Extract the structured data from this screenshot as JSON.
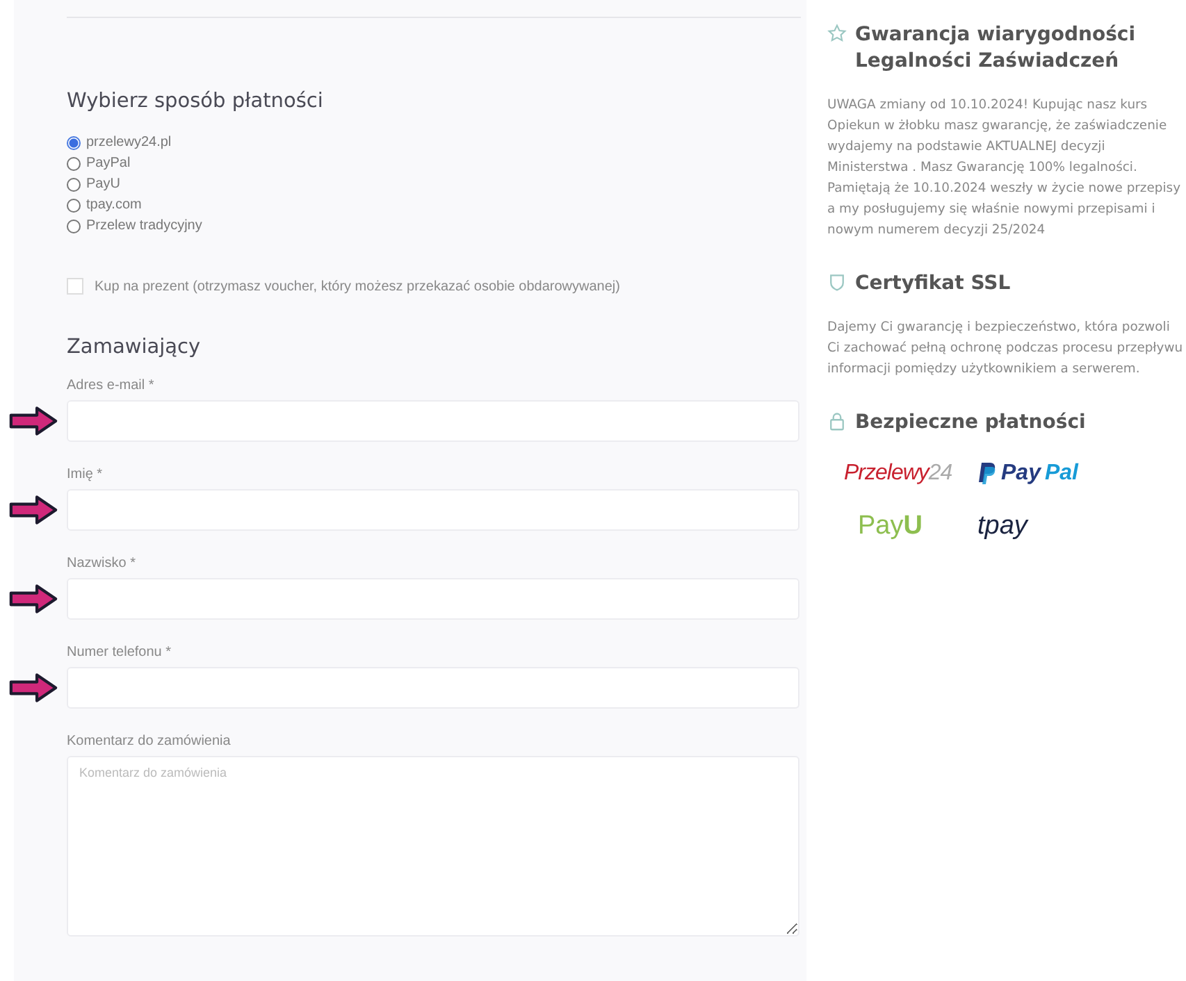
{
  "payment": {
    "title": "Wybierz sposób płatności",
    "methods": [
      {
        "label": "przelewy24.pl",
        "selected": true
      },
      {
        "label": "PayPal",
        "selected": false
      },
      {
        "label": "PayU",
        "selected": false
      },
      {
        "label": "tpay.com",
        "selected": false
      },
      {
        "label": "Przelew tradycyjny",
        "selected": false
      }
    ],
    "gift": {
      "label": "Kup na prezent (otrzymasz voucher, który możesz przekazać osobie obdarowywanej)",
      "checked": false
    }
  },
  "customer": {
    "title": "Zamawiający",
    "fields": [
      {
        "label": "Adres e-mail *",
        "kind": "input",
        "arrow": true
      },
      {
        "label": "Imię *",
        "kind": "input",
        "arrow": true
      },
      {
        "label": "Nazwisko *",
        "kind": "input",
        "arrow": true
      },
      {
        "label": "Numer telefonu *",
        "kind": "input",
        "arrow": true
      },
      {
        "label": "Komentarz do zamówienia",
        "kind": "textarea",
        "arrow": false,
        "placeholder": "Komentarz do zamówienia"
      }
    ]
  },
  "sidebar": [
    {
      "kind": "star",
      "title": "Gwarancja wiarygodności Legalności Zaświadczeń",
      "text": "UWAGA zmiany od 10.10.2024! Kupując nasz kurs Opiekun w żłobku masz gwarancję, że zaświadczenie wydajemy na podstawie AKTUALNEJ decyzji Ministerstwa . Masz Gwarancję 100% legalności. Pamiętają że 10.10.2024 weszły w życie nowe przepisy a my posługujemy się właśnie nowymi przepisami i nowym numerem decyzji 25/2024"
    },
    {
      "kind": "shield",
      "title": "Certyfikat SSL",
      "text": "Dajemy Ci gwarancję i bezpieczeństwo, która pozwoli Ci zachować pełną ochronę podczas procesu przepływu informacji pomiędzy użytkownikiem a serwerem."
    },
    {
      "kind": "lock",
      "title": "Bezpieczne płatności"
    }
  ],
  "logos": [
    {
      "kind": "przelewy24",
      "text": "Przelewy",
      "suffix": "24"
    },
    {
      "kind": "paypal",
      "text": "Pay",
      "suffix": "Pal"
    },
    {
      "kind": "payu",
      "text": "Pay",
      "suffix": "U"
    },
    {
      "kind": "tpay",
      "text": "tpay"
    }
  ]
}
